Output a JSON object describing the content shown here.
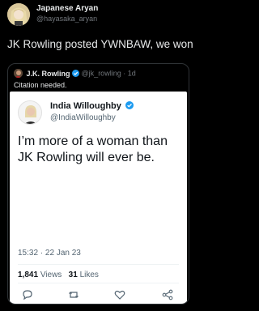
{
  "author": {
    "name": "Japanese Aryan",
    "handle": "@hayasaka_aryan",
    "avatar_icon": "anime-avatar"
  },
  "tweet": {
    "text": "JK Rowling posted YWNBAW, we won"
  },
  "quoted": {
    "name": "J.K. Rowling",
    "meta": "@jk_rowling · 1d",
    "text": "Citation needed.",
    "avatar_icon": "avatar"
  },
  "card": {
    "name": "India Willoughby",
    "handle": "@IndiaWilloughby",
    "text": "I’m more of a woman than JK Rowling will ever be.",
    "timestamp": "15:32 · 22 Jan 23",
    "views_count": "1,841",
    "views_label": "Views",
    "likes_count": "31",
    "likes_label": "Likes",
    "actions": [
      "reply-icon",
      "retweet-icon",
      "like-icon",
      "share-icon"
    ]
  },
  "colors": {
    "background": "#000000",
    "text_primary": "#e7e9ea",
    "text_secondary": "#71767b",
    "verified_blue": "#1d9bf0",
    "card_background": "#ffffff"
  }
}
